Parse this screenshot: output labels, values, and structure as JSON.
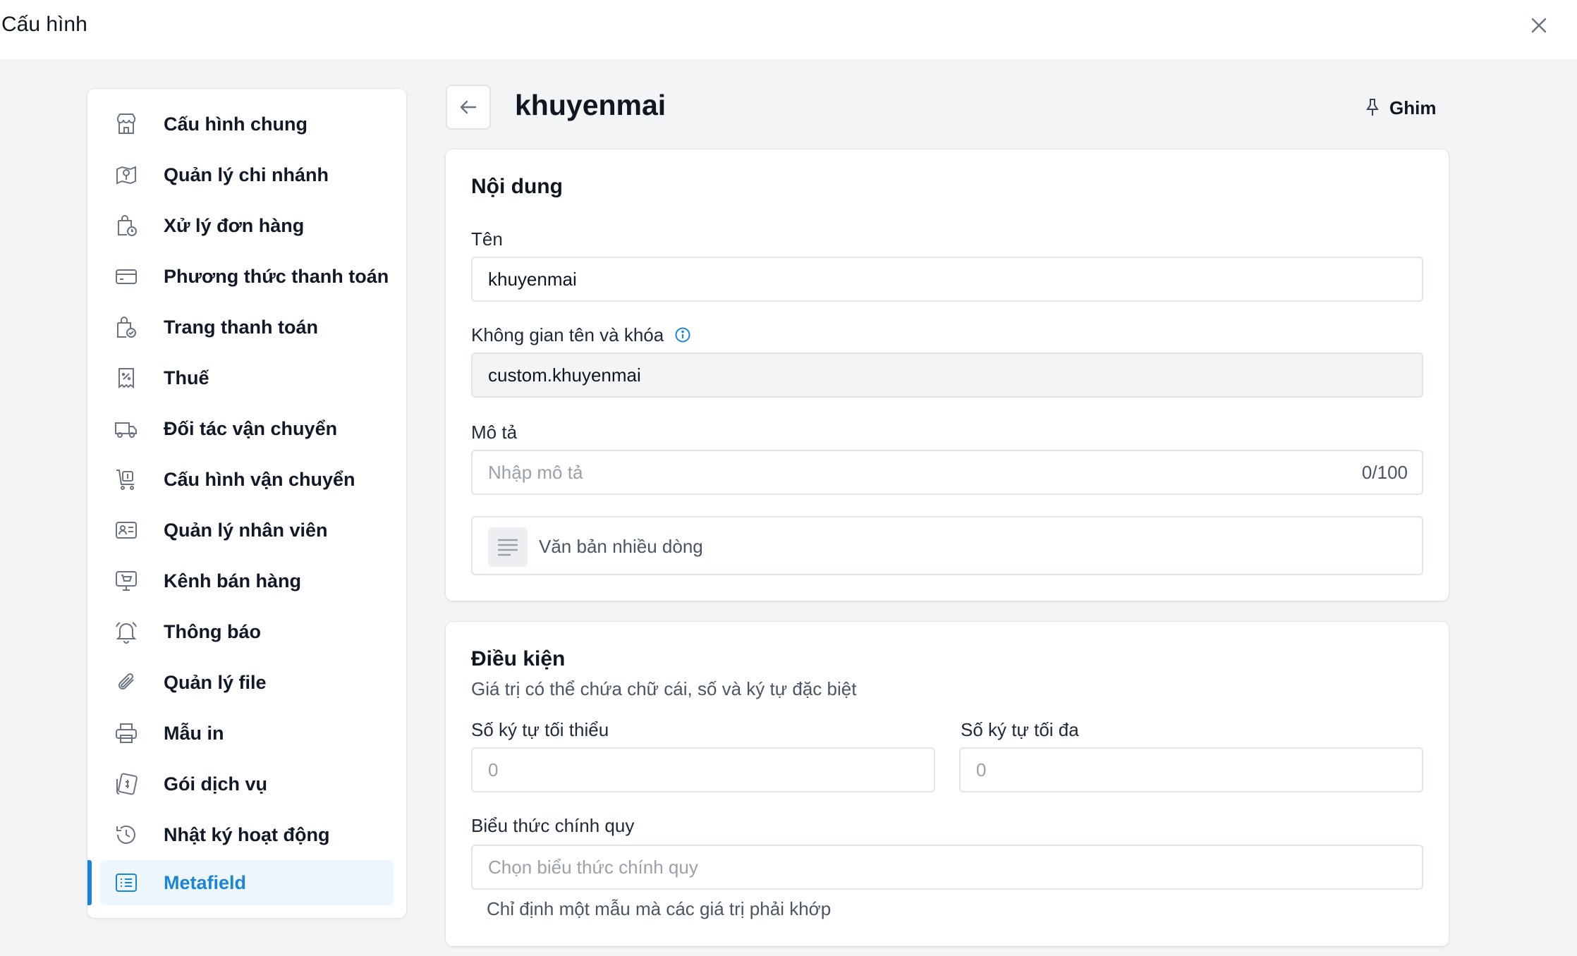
{
  "window": {
    "title": "Cấu hình",
    "close_icon": "close-icon"
  },
  "sidebar": {
    "items": [
      {
        "label": "Cấu hình chung",
        "icon": "store-icon"
      },
      {
        "label": "Quản lý chi nhánh",
        "icon": "map-pin-icon"
      },
      {
        "label": "Xử lý đơn hàng",
        "icon": "bag-clock-icon"
      },
      {
        "label": "Phương thức thanh toán",
        "icon": "credit-card-icon"
      },
      {
        "label": "Trang thanh toán",
        "icon": "bag-check-icon"
      },
      {
        "label": "Thuế",
        "icon": "receipt-percent-icon"
      },
      {
        "label": "Đối tác vận chuyển",
        "icon": "truck-icon"
      },
      {
        "label": "Cấu hình vận chuyển",
        "icon": "cart-dollar-icon"
      },
      {
        "label": "Quản lý nhân viên",
        "icon": "id-card-icon"
      },
      {
        "label": "Kênh bán hàng",
        "icon": "monitor-cart-icon"
      },
      {
        "label": "Thông báo",
        "icon": "bell-icon"
      },
      {
        "label": "Quản lý file",
        "icon": "paperclip-icon"
      },
      {
        "label": "Mẫu in",
        "icon": "printer-icon"
      },
      {
        "label": "Gói dịch vụ",
        "icon": "money-note-icon"
      },
      {
        "label": "Nhật ký hoạt động",
        "icon": "history-icon"
      },
      {
        "label": "Metafield",
        "icon": "list-card-icon",
        "active": true
      }
    ],
    "accent_color": "#1a84d6"
  },
  "header": {
    "title": "khuyenmai",
    "pin_label": "Ghim"
  },
  "content_card": {
    "title": "Nội dung",
    "name_label": "Tên",
    "name_value": "khuyenmai",
    "namespace_label": "Không gian tên và khóa",
    "namespace_value": "custom.khuyenmai",
    "description_label": "Mô tả",
    "description_placeholder": "Nhập mô tả",
    "description_counter": "0/100",
    "type_label": "Văn bản nhiều dòng"
  },
  "conditions_card": {
    "title": "Điều kiện",
    "subtitle": "Giá trị có thể chứa chữ cái, số và ký tự đặc biệt",
    "min_label": "Số ký tự tối thiểu",
    "min_placeholder": "0",
    "max_label": "Số ký tự tối đa",
    "max_placeholder": "0",
    "regex_label": "Biểu thức chính quy",
    "regex_placeholder": "Chọn biểu thức chính quy",
    "regex_hint": "Chỉ định một mẫu mà các giá trị phải khớp"
  }
}
